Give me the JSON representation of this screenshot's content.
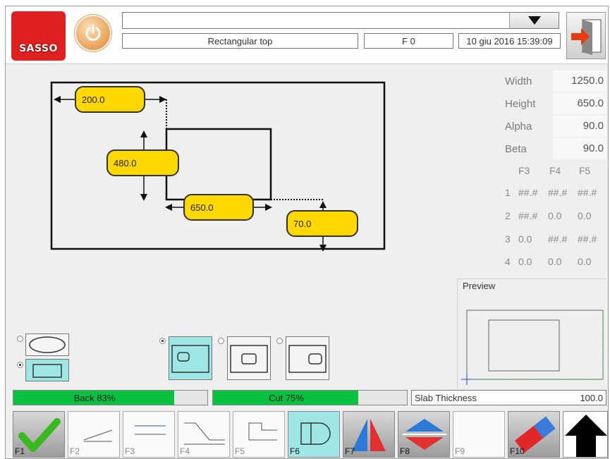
{
  "header": {
    "logo_text": "SASSO",
    "program_name": "Rectangular top",
    "function_code": "F 0",
    "datetime": "10 giu 2016 15:39:09"
  },
  "dimensions": {
    "d1": "200.0",
    "d2": "480.0",
    "d3": "650.0",
    "d4": "70.0"
  },
  "properties": [
    {
      "label": "Width",
      "value": "1250.0"
    },
    {
      "label": "Height",
      "value": "650.0"
    },
    {
      "label": "Alpha",
      "value": "90.0"
    },
    {
      "label": "Beta",
      "value": "90.0"
    }
  ],
  "f_table": {
    "headers": [
      "F3",
      "F4",
      "F5"
    ],
    "rows": [
      {
        "n": "1",
        "c": [
          "##.#",
          "##.#",
          "##.#"
        ]
      },
      {
        "n": "2",
        "c": [
          "##.#",
          "0.0",
          "0.0"
        ]
      },
      {
        "n": "3",
        "c": [
          "0.0",
          "##.#",
          "##.#"
        ]
      },
      {
        "n": "4",
        "c": [
          "0.0",
          "0.0",
          "0.0"
        ]
      }
    ]
  },
  "preview": {
    "label": "Preview"
  },
  "status": {
    "back_label": "Back 83%",
    "back_progress": 0.83,
    "cut_label": "Cut 75%",
    "cut_progress": 0.75,
    "slab_label": "Slab Thickness",
    "slab_value": "100.0"
  },
  "fkeys": [
    "F1",
    "F2",
    "F3",
    "F4",
    "F5",
    "F6",
    "F7",
    "F8",
    "F9",
    "F10"
  ],
  "colors": {
    "accent_yellow": "#ffd800",
    "progress_green": "#0ac040",
    "selected_cyan": "#9fe6e6",
    "logo_red": "#e02020"
  }
}
